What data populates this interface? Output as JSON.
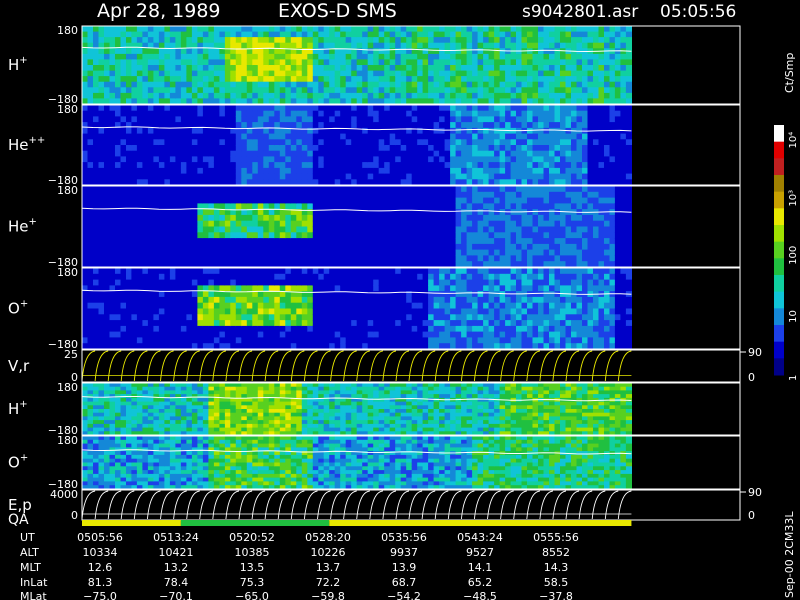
{
  "header": {
    "date": "Apr 28, 1989",
    "instrument": "EXOS-D SMS",
    "file": "s9042801.asr",
    "time": "05:05:56"
  },
  "chart_data": {
    "type": "heatmap",
    "colorbar": {
      "unit": "Ct/Smp",
      "tick_labels": [
        "1",
        "10",
        "100",
        "10³",
        "10⁴"
      ],
      "tick_values": [
        1,
        10,
        100,
        1000,
        10000
      ],
      "colors": [
        "#000088",
        "#0000c8",
        "#1c40e8",
        "#1488d8",
        "#10c4d8",
        "#10d0a0",
        "#20c040",
        "#58d020",
        "#a0e000",
        "#e8e800",
        "#c8a000",
        "#a08000",
        "#c02020",
        "#e00000",
        "#ffffff"
      ]
    },
    "panels": [
      {
        "id": "h-plus",
        "label": "H",
        "sup": "+",
        "y_top": "180",
        "y_bottom": "−180",
        "kind": "spectrogram",
        "palette": "hplus",
        "trace": true
      },
      {
        "id": "he-plusplus",
        "label": "He",
        "sup": "++",
        "y_top": "180",
        "y_bottom": "−180",
        "kind": "spectrogram",
        "palette": "heplusplus",
        "trace": true
      },
      {
        "id": "he-plus",
        "label": "He",
        "sup": "+",
        "y_top": "180",
        "y_bottom": "−180",
        "kind": "spectrogram",
        "palette": "heplus",
        "trace": true
      },
      {
        "id": "o-plus",
        "label": "O",
        "sup": "+",
        "y_top": "180",
        "y_bottom": "−180",
        "kind": "spectrogram",
        "palette": "oplus",
        "trace": true
      },
      {
        "id": "vr",
        "label": "V,r",
        "sup": "",
        "y_top": "25",
        "y_bottom": "0",
        "kind": "sweep",
        "right_top": "90",
        "right_bottom": "0"
      },
      {
        "id": "h-plus-2",
        "label": "H",
        "sup": "+",
        "y_top": "180",
        "y_bottom": "−180",
        "kind": "spectrogram",
        "palette": "hplus2",
        "trace": true
      },
      {
        "id": "o-plus-2",
        "label": "O",
        "sup": "+",
        "y_top": "180",
        "y_bottom": "−180",
        "kind": "spectrogram",
        "palette": "oplus2",
        "trace": true
      },
      {
        "id": "ep",
        "label": "E,p",
        "sup": "",
        "y_top": "4000",
        "y_bottom": "0",
        "kind": "sweep",
        "right_top": "90",
        "right_bottom": "0"
      }
    ],
    "qa": {
      "label": "QA",
      "segments": [
        {
          "start": 0.0,
          "end": 0.18,
          "color": "#e8e800"
        },
        {
          "start": 0.18,
          "end": 0.45,
          "color": "#20c040"
        },
        {
          "start": 0.45,
          "end": 1.0,
          "color": "#e8e800"
        }
      ]
    },
    "data_end_fraction": 0.835,
    "orbit_table": {
      "row_labels": [
        "UT",
        "ALT",
        "MLT",
        "InLat",
        "MLat"
      ],
      "columns": [
        {
          "UT": "0505:56",
          "ALT": "10334",
          "MLT": "12.6",
          "InLat": "81.3",
          "MLat": "−75.0"
        },
        {
          "UT": "0513:24",
          "ALT": "10421",
          "MLT": "13.2",
          "InLat": "78.4",
          "MLat": "−70.1"
        },
        {
          "UT": "0520:52",
          "ALT": "10385",
          "MLT": "13.5",
          "InLat": "75.3",
          "MLat": "−65.0"
        },
        {
          "UT": "0528:20",
          "ALT": "10226",
          "MLT": "13.7",
          "InLat": "72.2",
          "MLat": "−59.8"
        },
        {
          "UT": "0535:56",
          "ALT": "9937",
          "MLT": "13.9",
          "InLat": "68.7",
          "MLat": "−54.2"
        },
        {
          "UT": "0543:24",
          "ALT": "9527",
          "MLT": "14.1",
          "InLat": "65.2",
          "MLat": "−48.5"
        },
        {
          "UT": "0555:56",
          "ALT": "8552",
          "MLT": "14.3",
          "InLat": "58.5",
          "MLat": "−37.8"
        }
      ]
    },
    "footer_note": "Sep-00 2CM33L"
  }
}
